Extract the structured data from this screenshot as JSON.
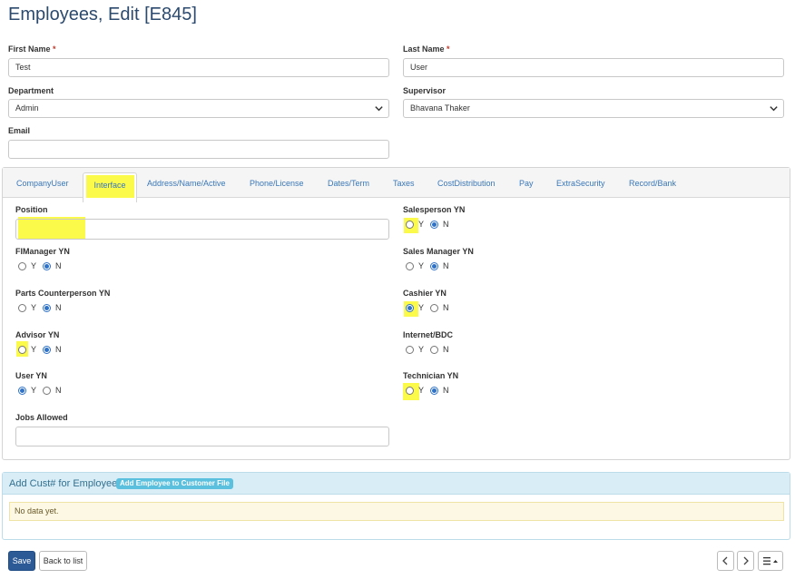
{
  "page": {
    "title": "Employees, Edit [E845]"
  },
  "fields": {
    "first_name": {
      "label": "First Name",
      "required_mark": "*",
      "value": "Test"
    },
    "last_name": {
      "label": "Last Name",
      "required_mark": "*",
      "value": "User"
    },
    "department": {
      "label": "Department",
      "value": "Admin"
    },
    "supervisor": {
      "label": "Supervisor",
      "value": "Bhavana Thaker"
    },
    "email": {
      "label": "Email",
      "value": ""
    }
  },
  "tabs": [
    {
      "label": "CompanyUser"
    },
    {
      "label": "Interface",
      "active": true
    },
    {
      "label": "Address/Name/Active"
    },
    {
      "label": "Phone/License"
    },
    {
      "label": "Dates/Term"
    },
    {
      "label": "Taxes"
    },
    {
      "label": "CostDistribution"
    },
    {
      "label": "Pay"
    },
    {
      "label": "ExtraSecurity"
    },
    {
      "label": "Record/Bank"
    }
  ],
  "interface": {
    "position": {
      "label": "Position",
      "value": ""
    },
    "jobs_allowed": {
      "label": "Jobs Allowed",
      "value": ""
    },
    "radio_y": "Y",
    "radio_n": "N",
    "yn_groups": [
      {
        "label": "Salesperson YN",
        "selected": "N"
      },
      {
        "label": "FIManager YN",
        "selected": "N"
      },
      {
        "label": "Sales Manager YN",
        "selected": "N"
      },
      {
        "label": "Parts Counterperson YN",
        "selected": "N"
      },
      {
        "label": "Cashier YN",
        "selected": "Y"
      },
      {
        "label": "Advisor YN",
        "selected": "N"
      },
      {
        "label": "Internet/BDC",
        "selected": ""
      },
      {
        "label": "User YN",
        "selected": "Y"
      },
      {
        "label": "Technician YN",
        "selected": "N"
      }
    ]
  },
  "cust_section": {
    "title": "Add Cust# for Employee",
    "add_button": "Add Employee to Customer File",
    "empty_text": "No data yet."
  },
  "footer": {
    "save": "Save",
    "back": "Back to list",
    "prev_icon": "chevron-left-icon",
    "next_icon": "chevron-right-icon",
    "menu_icon": "hamburger-menu-icon"
  },
  "colors": {
    "title": "#2c4a6e",
    "link": "#3a77b8",
    "highlight": "#fbf94a",
    "primary_button": "#2c5a96",
    "info_header": "#d9edf7",
    "info_badge": "#5bc0de",
    "warning_bg": "#fcf8e3"
  }
}
